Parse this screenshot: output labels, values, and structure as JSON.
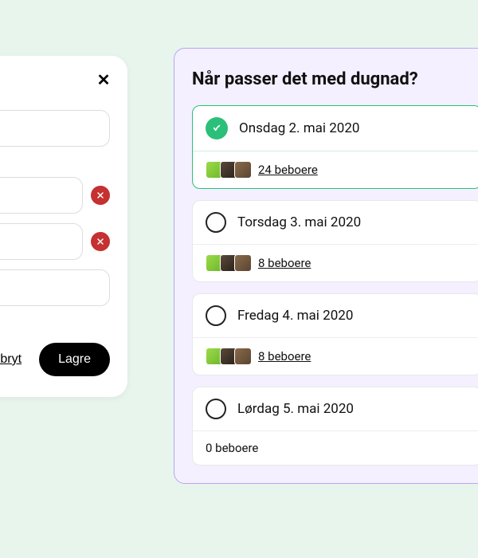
{
  "edit": {
    "cancel_label": "Avbryt",
    "save_label": "Lagre"
  },
  "poll": {
    "title": "Når passer det med dugnad?",
    "options": [
      {
        "label": "Onsdag 2. mai 2020",
        "count_label": "24 beboere",
        "selected": true,
        "has_respondents": true
      },
      {
        "label": "Torsdag 3. mai 2020",
        "count_label": "8 beboere",
        "selected": false,
        "has_respondents": true
      },
      {
        "label": "Fredag 4. mai 2020",
        "count_label": "8 beboere",
        "selected": false,
        "has_respondents": true
      },
      {
        "label": "Lørdag 5. mai 2020",
        "count_label": "0 beboere",
        "selected": false,
        "has_respondents": false
      }
    ]
  }
}
